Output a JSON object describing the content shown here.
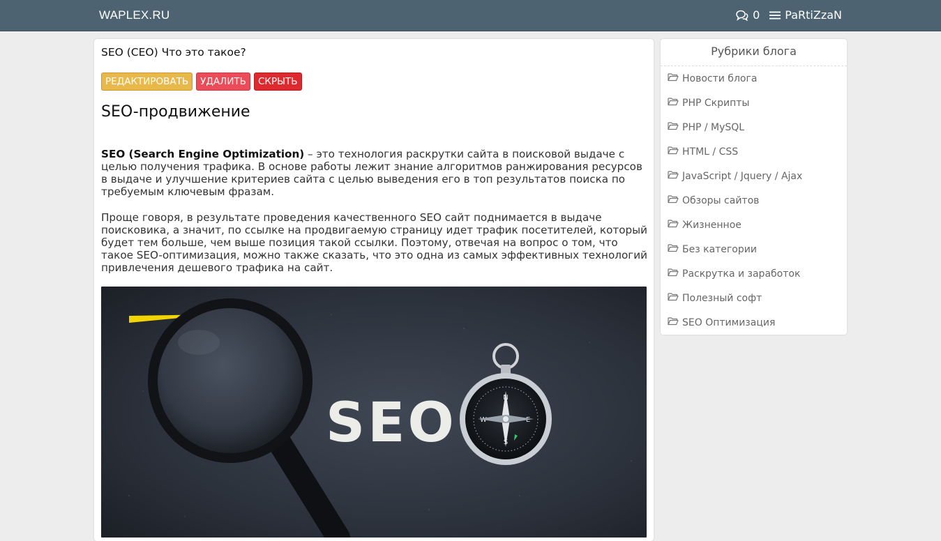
{
  "header": {
    "brand": "WAPLEX.RU",
    "messages_count": "0",
    "user_name": "PaRtiZzaN",
    "bg_color": "#4d6372"
  },
  "post": {
    "title": "SEO (CEO) Что это такое?",
    "buttons": {
      "edit": "РЕДАКТИРОВАТЬ",
      "delete": "УДАЛИТЬ",
      "hide": "СКРЫТЬ"
    },
    "heading": "SEO-продвижение",
    "p1_bold": "SEO (Search Engine Optimization)",
    "p1_rest": " – это технология раскрутки сайта в поисковой выдаче с целью получения трафика. В основе работы лежит знание алгоритмов ранжирования ресурсов в выдаче и улучшение критериев сайта с целью выведения его в топ результатов поиска по требуемым ключевым фразам.",
    "p2": "Проще говоря, в результате проведения качественного SEO сайт поднимается в выдаче поисковика, а значит, по ссылке на продвигаемую страницу идет трафик посетителей, который будет тем больше, чем выше позиция такой ссылки. Поэтому, отвечая на вопрос о том, что такое SEO-оптимизация, можно также сказать, что это одна из самых эффективных технологий привлечения дешевого трафика на сайт.",
    "image_text": "SEO"
  },
  "sidebar": {
    "title": "Рубрики блога",
    "categories": [
      "Новости блога",
      "PHP Скрипты",
      "PHP / MySQL",
      "HTML / CSS",
      "JavaScript / Jquery / Ajax",
      "Обзоры сайтов",
      "Жизненное",
      "Без категории",
      "Раскрутка и заработок",
      "Полезный софт",
      "SEO Оптимизация"
    ]
  },
  "icons": {
    "messages": "comments-icon",
    "menu": "hamburger-icon",
    "category": "folder-open-icon"
  }
}
